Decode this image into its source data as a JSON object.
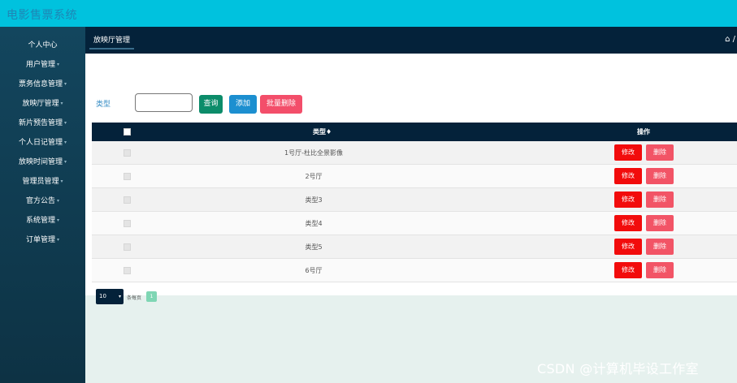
{
  "app": {
    "title": "电影售票系统"
  },
  "sidebar": {
    "items": [
      {
        "label": "个人中心",
        "has_caret": false
      },
      {
        "label": "用户管理",
        "has_caret": true
      },
      {
        "label": "票务信息管理",
        "has_caret": true
      },
      {
        "label": "放映厅管理",
        "has_caret": true
      },
      {
        "label": "新片预告管理",
        "has_caret": true
      },
      {
        "label": "个人日记管理",
        "has_caret": true
      },
      {
        "label": "放映时间管理",
        "has_caret": true
      },
      {
        "label": "管理员管理",
        "has_caret": true
      },
      {
        "label": "官方公告",
        "has_caret": true
      },
      {
        "label": "系统管理",
        "has_caret": true
      },
      {
        "label": "订单管理",
        "has_caret": true
      }
    ],
    "caret": "▾"
  },
  "tabbar": {
    "active_tab": "放映厅管理",
    "home_crumb": "⌂ /"
  },
  "filter": {
    "label": "类型",
    "value": "",
    "placeholder": ""
  },
  "toolbar": {
    "query_label": "查询",
    "add_label": "添加",
    "batch_delete_label": "批量删除"
  },
  "table": {
    "headers": {
      "type": "类型♦",
      "ops": "操作"
    },
    "rows": [
      {
        "type": "1号厅-杜比全景影像",
        "edit": "修改",
        "delete": "删除"
      },
      {
        "type": "2号厅",
        "edit": "修改",
        "delete": "删除"
      },
      {
        "type": "类型3",
        "edit": "修改",
        "delete": "删除"
      },
      {
        "type": "类型4",
        "edit": "修改",
        "delete": "删除"
      },
      {
        "type": "类型5",
        "edit": "修改",
        "delete": "删除"
      },
      {
        "type": "6号厅",
        "edit": "修改",
        "delete": "删除"
      }
    ]
  },
  "pagination": {
    "page_size": "10",
    "per_page_label": "条每页",
    "current_page": "1"
  },
  "colors": {
    "topbar": "#00c2de",
    "sidebar": "#13465e",
    "header_dark": "#04223a",
    "edit_button": "#f20c0c",
    "delete_button": "#f25466"
  },
  "watermark": "CSDN @计算机毕设工作室"
}
